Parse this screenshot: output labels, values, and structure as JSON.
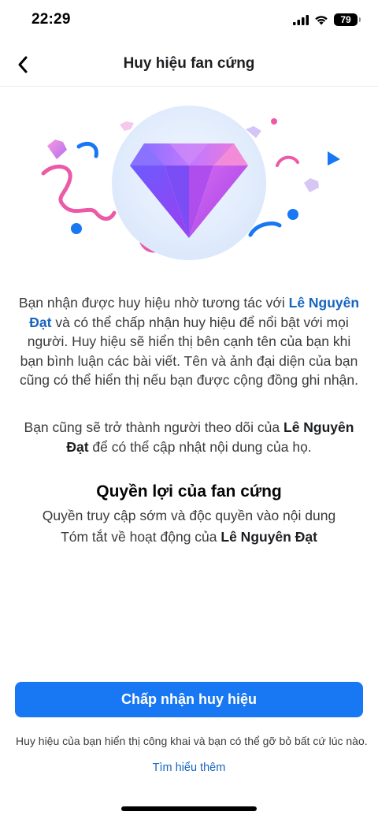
{
  "status_bar": {
    "time": "22:29",
    "battery": "79"
  },
  "header": {
    "title": "Huy hiệu fan cứng"
  },
  "description": {
    "part1": "Bạn nhận được huy hiệu nhờ tương tác với ",
    "name": "Lê Nguyên Đạt",
    "part2": " và có thể chấp nhận huy hiệu để nổi bật với mọi người. Huy hiệu sẽ hiển thị bên cạnh tên của bạn khi bạn bình luận các bài viết. Tên và ảnh đại diện của bạn cũng có thể hiển thị nếu bạn được cộng đồng ghi nhận."
  },
  "follow": {
    "part1": "Bạn cũng sẽ trở thành người theo dõi của ",
    "name": "Lê Nguyên Đạt",
    "part2": " để có thể cập nhật nội dung của họ."
  },
  "benefits": {
    "title": "Quyền lợi của fan cứng",
    "item1": "Quyền truy cập sớm và độc quyền vào nội dung",
    "item2_prefix": "Tóm tắt về hoạt động của ",
    "item2_name": "Lê Nguyên Đạt"
  },
  "actions": {
    "accept_label": "Chấp nhận huy hiệu"
  },
  "footer": {
    "note": "Huy hiệu của bạn hiển thị công khai và bạn có thể gỡ bỏ bất cứ lúc nào.",
    "learn_more": "Tìm hiểu thêm"
  },
  "colors": {
    "accent": "#1877f2",
    "link": "#1665c0",
    "confetti_pink": "#e85aa4",
    "confetti_blue": "#1877f2",
    "diamond_purple": "#8a4dff"
  }
}
